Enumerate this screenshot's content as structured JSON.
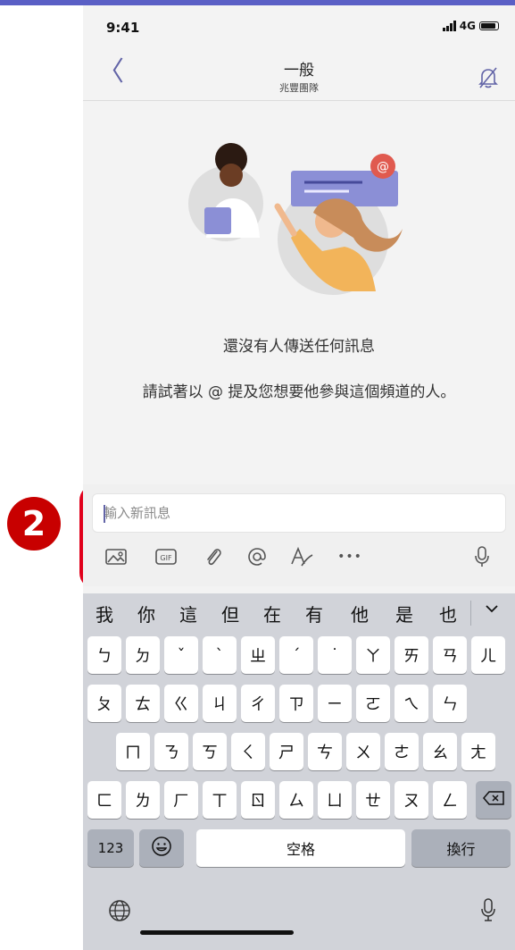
{
  "status": {
    "time": "9:41",
    "network": "4G"
  },
  "header": {
    "back_glyph": "〈",
    "title": "一般",
    "subtitle": "兆豐團隊",
    "mute_icon": "bell-off-icon"
  },
  "empty_state": {
    "title": "還沒有人傳送任何訊息",
    "subtitle": "請試著以 @ 提及您想要他參與這個頻道的人。"
  },
  "composer": {
    "placeholder": "輸入新訊息",
    "tools": [
      "image-icon",
      "gif-icon",
      "attach-icon",
      "mention-icon",
      "format-icon",
      "more-icon",
      "mic-icon"
    ],
    "gif_label": "GIF",
    "more_label": "•••"
  },
  "annotation": {
    "step": "2",
    "color": "#e0001b"
  },
  "keyboard": {
    "candidates": [
      "我",
      "你",
      "這",
      "但",
      "在",
      "有",
      "他",
      "是",
      "也"
    ],
    "row1": [
      "ㄅ",
      "ㄉ",
      "ˇ",
      "ˋ",
      "ㄓ",
      "ˊ",
      "˙",
      "ㄚ",
      "ㄞ",
      "ㄢ",
      "ㄦ"
    ],
    "row2": [
      "ㄆ",
      "ㄊ",
      "ㄍ",
      "ㄐ",
      "ㄔ",
      "ㄗ",
      "ㄧ",
      "ㄛ",
      "ㄟ",
      "ㄣ"
    ],
    "row3": [
      "ㄇ",
      "ㄋ",
      "ㄎ",
      "ㄑ",
      "ㄕ",
      "ㄘ",
      "ㄨ",
      "ㄜ",
      "ㄠ",
      "ㄤ"
    ],
    "row4": [
      "ㄈ",
      "ㄌ",
      "ㄏ",
      "ㄒ",
      "ㄖ",
      "ㄙ",
      "ㄩ",
      "ㄝ",
      "ㄡ",
      "ㄥ"
    ],
    "numbers_label": "123",
    "space_label": "空格",
    "return_label": "換行"
  },
  "colors": {
    "accent": "#6264a7",
    "annotation_red": "#e0001b",
    "topbar": "#5a5fc5"
  }
}
